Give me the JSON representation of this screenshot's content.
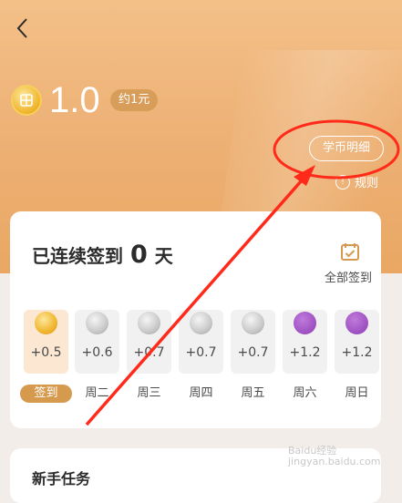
{
  "header": {
    "back_icon": "chevron-left-icon"
  },
  "wallet": {
    "coin_icon": "coin-icon",
    "balance": "1.0",
    "approx": "约1元",
    "detail_button": "学币明细",
    "rules_icon": "info-icon",
    "rules_label": "规则"
  },
  "checkin": {
    "streak_prefix": "已连续签到",
    "streak_count": "0",
    "streak_suffix": "天",
    "calendar_icon": "calendar-check-icon",
    "all_label": "全部签到",
    "days": [
      {
        "reward": "+0.5",
        "label": "签到",
        "icon": "gold-coin-icon"
      },
      {
        "reward": "+0.6",
        "label": "周二",
        "icon": "silver-coin-icon"
      },
      {
        "reward": "+0.7",
        "label": "周三",
        "icon": "silver-coin-icon"
      },
      {
        "reward": "+0.7",
        "label": "周四",
        "icon": "silver-coin-icon"
      },
      {
        "reward": "+0.7",
        "label": "周五",
        "icon": "silver-coin-icon"
      },
      {
        "reward": "+1.2",
        "label": "周六",
        "icon": "gift-icon"
      },
      {
        "reward": "+1.2",
        "label": "周日",
        "icon": "gift-icon"
      }
    ]
  },
  "tasks": {
    "title": "新手任务"
  },
  "watermark": {
    "line1": "Baidu经验",
    "line2": "jingyan.baidu.com"
  },
  "colors": {
    "accent": "#d69a4f",
    "annotation": "#ff2a1a",
    "hero": "#eeb277"
  }
}
